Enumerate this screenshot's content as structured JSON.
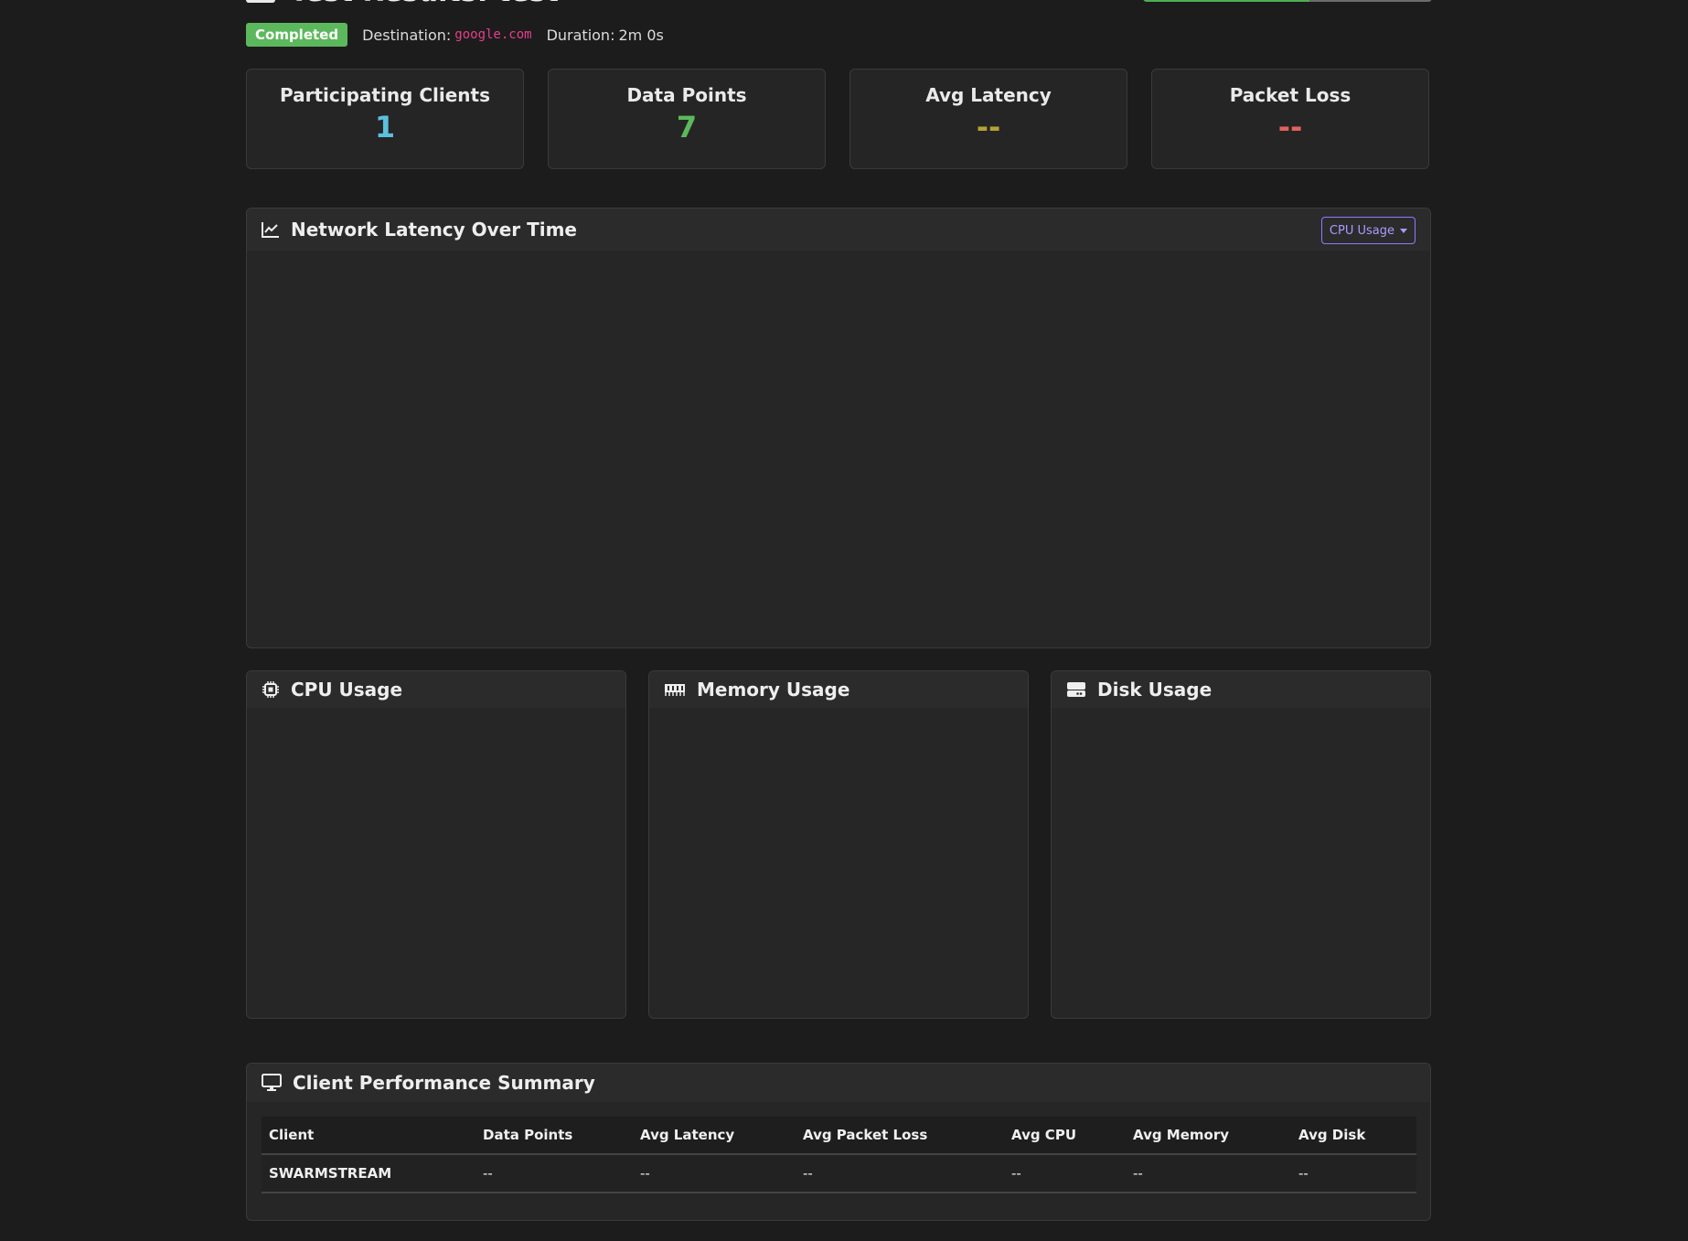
{
  "header": {
    "title": "Test Results: test",
    "status_badge": "Completed",
    "destination_label": "Destination:",
    "destination_value": "google.com",
    "duration_label": "Duration:",
    "duration_value": "2m 0s"
  },
  "stats": [
    {
      "label": "Participating Clients",
      "value": "1",
      "color": "#5bc0de"
    },
    {
      "label": "Data Points",
      "value": "7",
      "color": "#5cb85c"
    },
    {
      "label": "Avg Latency",
      "value": "--",
      "color": "#b5a234"
    },
    {
      "label": "Packet Loss",
      "value": "--",
      "color": "#e3625a"
    }
  ],
  "latency_chart": {
    "title": "Network Latency Over Time",
    "icon": "line-chart-icon",
    "dropdown_label": "CPU Usage"
  },
  "resource_cards": [
    {
      "title": "CPU Usage",
      "icon": "cpu-icon"
    },
    {
      "title": "Memory Usage",
      "icon": "memory-icon"
    },
    {
      "title": "Disk Usage",
      "icon": "disk-icon"
    }
  ],
  "summary": {
    "title": "Client Performance Summary",
    "icon": "desktop-icon",
    "columns": [
      "Client",
      "Data Points",
      "Avg Latency",
      "Avg Packet Loss",
      "Avg CPU",
      "Avg Memory",
      "Avg Disk"
    ],
    "rows": [
      [
        "SWARMSTREAM",
        "--",
        "--",
        "--",
        "--",
        "--",
        "--"
      ]
    ]
  },
  "colors": {
    "background": "#1c1c1c",
    "card": "#262626",
    "badge": "#5cb85c",
    "destination": "#e83e8c",
    "dropdown_accent": "#a89cff"
  }
}
